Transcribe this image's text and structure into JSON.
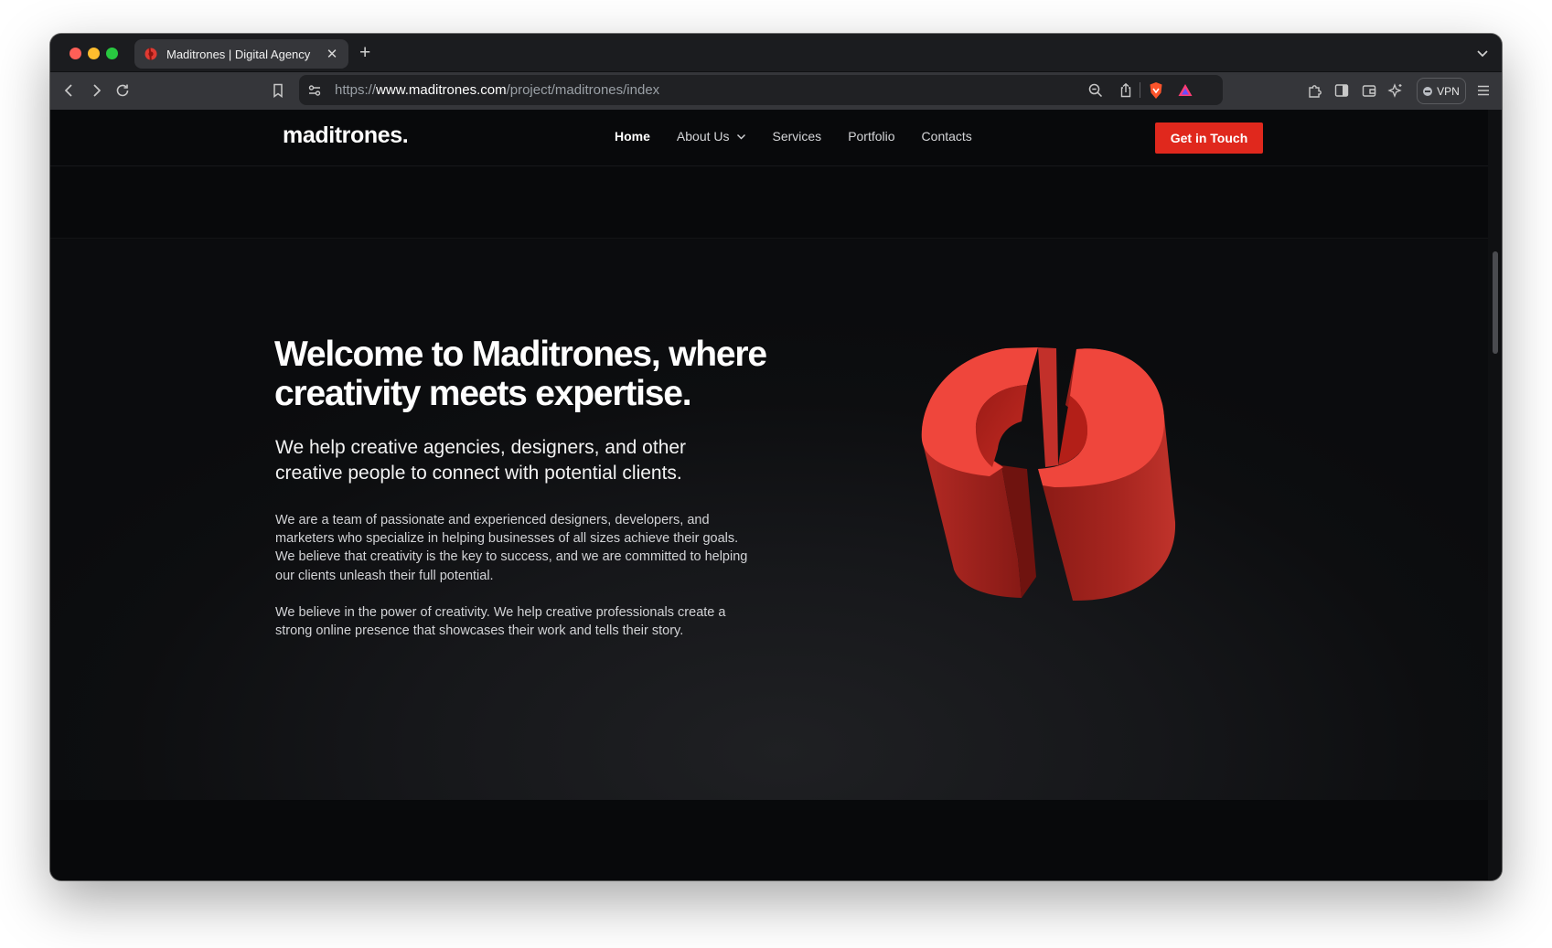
{
  "browser": {
    "tab": {
      "title": "Maditrones | Digital Agency"
    },
    "new_tab_label": "+",
    "close_tab_label": "✕",
    "url": {
      "scheme": "https://",
      "host": "www.maditrones.com",
      "path": "/project/maditrones/index"
    },
    "vpn_label": "VPN"
  },
  "site": {
    "logo": "maditrones.",
    "nav": [
      {
        "label": "Home",
        "active": true
      },
      {
        "label": "About Us",
        "dropdown": true
      },
      {
        "label": "Services"
      },
      {
        "label": "Portfolio"
      },
      {
        "label": "Contacts"
      }
    ],
    "cta_label": "Get in Touch",
    "accent_color": "#e0281d"
  },
  "hero": {
    "title_line1": "Welcome to Maditrones, where",
    "title_line2": "creativity meets expertise.",
    "subtitle": "We help creative agencies, designers, and other creative people to connect with potential clients.",
    "paragraph1": "We are a team of passionate and experienced designers, developers, and marketers who specialize in helping businesses of all sizes achieve their goals. We believe that creativity is the key to success, and we are committed to helping our clients unleash their full potential.",
    "paragraph2": "We believe in the power of creativity. We help creative professionals create a strong online presence that showcases their work and tells their story.",
    "graphic": "red-3d-logo-mark"
  }
}
